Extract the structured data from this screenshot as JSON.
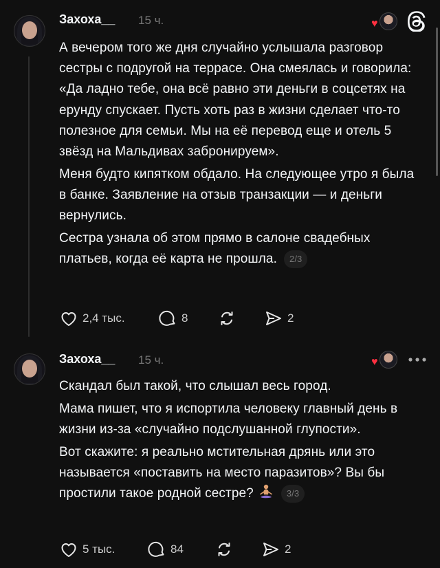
{
  "posts": [
    {
      "username": "Захоха__",
      "time": "15 ч.",
      "paragraphs": [
        "А вечером того же дня случайно услышала разговор сестры с подругой на террасе. Она смеялась и говорила: «Да ладно тебе, она всё равно эти деньги в соцсетях на ерунду спускает. Пусть хоть раз в жизни сделает что-то полезное для семьи. Мы на её перевод еще и отель 5 звёзд на Мальдивах забронируем».",
        "Меня будто кипятком обдало. На следующее утро я была в банке. Заявление на отзыв транзакции — и деньги вернулись.",
        "Сестра узнала об этом прямо в салоне свадебных платьев, когда её карта не прошла."
      ],
      "pager": "2/3",
      "likes": "2,4 тыс.",
      "replies": "8",
      "shares": "2",
      "top_right_icon": "threads-logo-icon"
    },
    {
      "username": "Захоха__",
      "time": "15 ч.",
      "paragraphs": [
        "Скандал был такой, что слышал весь город.",
        "Мама пишет, что я испортила человеку главный день в жизни из-за «случайно подслушанной глупости».",
        "Вот скажите: я реально мстительная дрянь или это называется «поставить на место паразитов»? Вы бы простили такое родной сестре?"
      ],
      "pager": "3/3",
      "likes": "5 тыс.",
      "replies": "84",
      "shares": "2",
      "top_right_icon": "more-options-icon",
      "emoji": "meditating-person-emoji"
    }
  ],
  "colors": {
    "background": "#101010",
    "text": "#f3f5f7",
    "secondary": "#777777",
    "heart": "#ff3040"
  }
}
